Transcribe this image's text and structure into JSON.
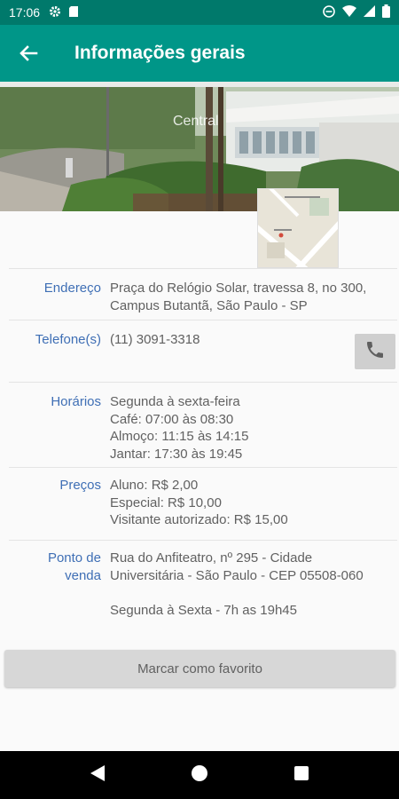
{
  "status_bar": {
    "time": "17:06",
    "icons": [
      "gear-icon",
      "sd-card-icon",
      "do-not-disturb-icon",
      "wifi-icon",
      "signal-icon",
      "battery-icon"
    ]
  },
  "app_bar": {
    "title": "Informações gerais",
    "back_icon": "arrow-back-icon",
    "color": "#009688",
    "status_color": "#00796b"
  },
  "hero": {
    "caption": "Central"
  },
  "info": {
    "address": {
      "label": "Endereço",
      "lines": [
        "Praça do Relógio Solar, travessa 8, no 300,",
        "Campus Butantã, São Paulo - SP"
      ]
    },
    "phone": {
      "label": "Telefone(s)",
      "value": "(11) 3091-3318",
      "call_icon": "phone-icon"
    },
    "hours": {
      "label": "Horários",
      "lines": [
        "Segunda à sexta-feira",
        "Café: 07:00 às 08:30",
        "Almoço: 11:15 às 14:15",
        "Jantar: 17:30 às 19:45"
      ]
    },
    "prices": {
      "label": "Preços",
      "lines": [
        "Aluno: R$ 2,00",
        "Especial: R$ 10,00",
        "Visitante autorizado: R$ 15,00"
      ]
    },
    "sale_point": {
      "label_lines": [
        "Ponto de",
        "venda"
      ],
      "lines": [
        "Rua do Anfiteatro, nº 295 - Cidade",
        "Universitária - São Paulo - CEP 05508-060"
      ],
      "schedule": "Segunda à Sexta - 7h as 19h45"
    }
  },
  "favorite_button": {
    "label": "Marcar como favorito"
  },
  "nav_bar": {
    "icons": [
      "back-triangle-icon",
      "home-circle-icon",
      "recents-square-icon"
    ]
  },
  "colors": {
    "label_blue": "#3f6fb5",
    "value_gray": "#616161"
  }
}
